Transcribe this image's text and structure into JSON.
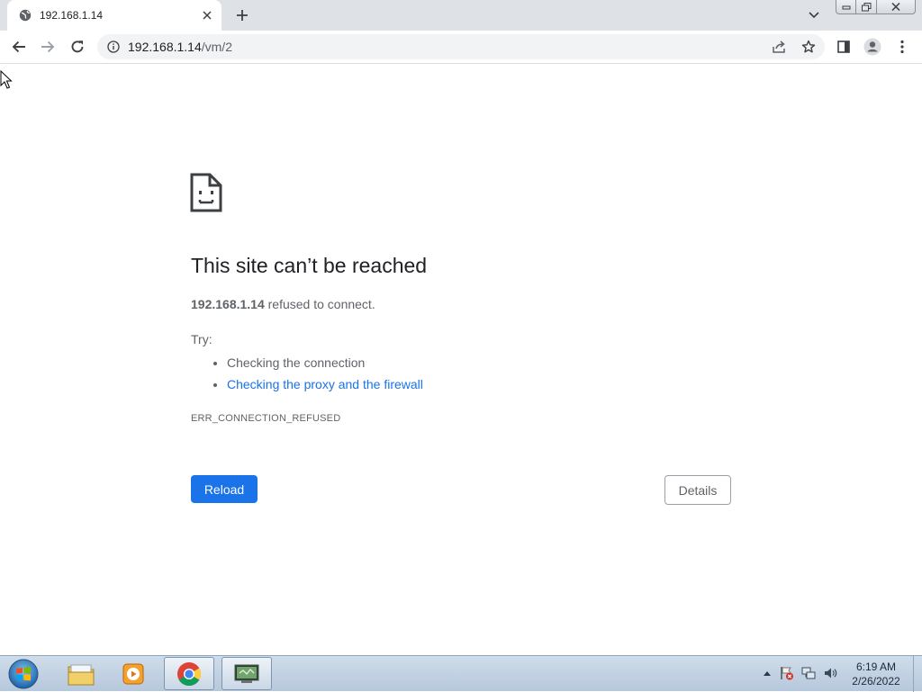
{
  "browser": {
    "tab": {
      "title": "192.168.1.14"
    },
    "address": {
      "host": "192.168.1.14",
      "path": "/vm/2"
    }
  },
  "error_page": {
    "heading": "This site can’t be reached",
    "host": "192.168.1.14",
    "desc_suffix": " refused to connect.",
    "try_label": "Try:",
    "suggestions": [
      "Checking the connection",
      "Checking the proxy and the firewall"
    ],
    "error_code": "ERR_CONNECTION_REFUSED",
    "reload_label": "Reload",
    "details_label": "Details"
  },
  "taskbar": {
    "apps": [
      "start-orb",
      "file-explorer",
      "media-player",
      "chrome",
      "vm-console"
    ],
    "clock": {
      "time": "6:19 AM",
      "date": "2/26/2022"
    }
  },
  "colors": {
    "accent": "#1a73e8",
    "tabstrip": "#dee1e6",
    "omnibox": "#f1f3f4",
    "text_secondary": "#5f6368",
    "taskbar": "#c3d3e4"
  }
}
